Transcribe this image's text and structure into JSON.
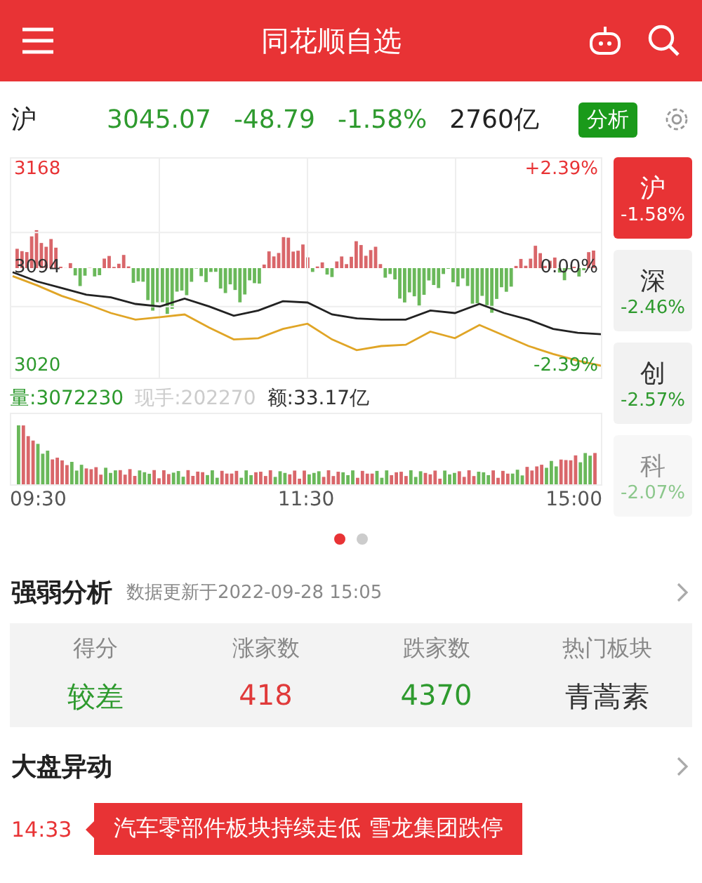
{
  "header": {
    "title": "同花顺自选"
  },
  "quote": {
    "market": "沪",
    "price": "3045.07",
    "change": "-48.79",
    "percent": "-1.58%",
    "turnover": "2760亿",
    "analysis_button": "分析"
  },
  "chart_data": {
    "type": "line",
    "ylim": [
      3010,
      3178
    ],
    "grid": true,
    "yticks": [
      {
        "value": 3168,
        "label": "3168"
      },
      {
        "value": 3094,
        "label": "3094"
      },
      {
        "value": 3020,
        "label": "3020"
      }
    ],
    "series": [
      {
        "color": "#222222",
        "values": [
          3092,
          3085,
          3080,
          3075,
          3073,
          3068,
          3066,
          3072,
          3066,
          3059,
          3063,
          3070,
          3069,
          3060,
          3057,
          3056,
          3056,
          3063,
          3061,
          3068,
          3061,
          3056,
          3049,
          3046,
          3045
        ]
      },
      {
        "color": "#e0a526",
        "values": [
          3089,
          3082,
          3074,
          3068,
          3061,
          3056,
          3058,
          3060,
          3050,
          3041,
          3042,
          3049,
          3053,
          3041,
          3033,
          3036,
          3037,
          3047,
          3042,
          3052,
          3044,
          3036,
          3030,
          3025,
          3021
        ]
      }
    ]
  },
  "time_labels": [
    "09:30",
    "11:30",
    "15:00"
  ],
  "right_labels": [
    "+2.39%",
    "0.00%",
    "-2.39%"
  ],
  "volume_info": {
    "volume": "量:3072230",
    "current": "现手:202270",
    "amount": "额:33.17亿"
  },
  "indices": [
    {
      "name": "沪",
      "percent": "-1.58%",
      "selected": true,
      "faded": false
    },
    {
      "name": "深",
      "percent": "-2.46%",
      "selected": false,
      "faded": false
    },
    {
      "name": "创",
      "percent": "-2.57%",
      "selected": false,
      "faded": false
    },
    {
      "name": "科",
      "percent": "-2.07%",
      "selected": false,
      "faded": true
    }
  ],
  "pager": [
    {
      "selected": true
    },
    {
      "selected": false
    }
  ],
  "strength": {
    "title": "强弱分析",
    "updated": "数据更新于2022-09-28 15:05",
    "columns": [
      {
        "label": "得分",
        "value": "较差",
        "color": "#2e9a2e"
      },
      {
        "label": "涨家数",
        "value": "418",
        "color": "#e03a3a"
      },
      {
        "label": "跌家数",
        "value": "4370",
        "color": "#2e9a2e"
      },
      {
        "label": "热门板块",
        "value": "青蒿素",
        "color": "#333333"
      }
    ]
  },
  "movement": {
    "title": "大盘异动",
    "time": "14:33",
    "text": "汽车零部件板块持续走低 雪龙集团跌停"
  }
}
